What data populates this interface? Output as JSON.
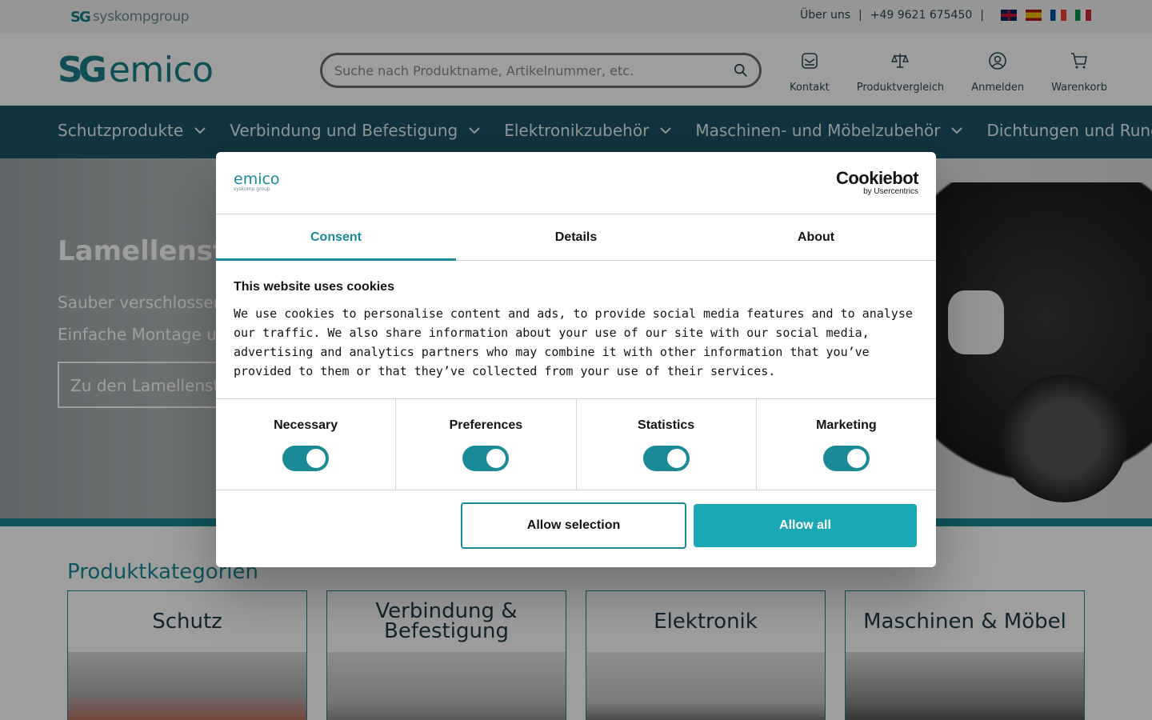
{
  "topbar": {
    "group_logo": {
      "mark": "SG",
      "name": "syskompgroup"
    },
    "links": [
      "Über uns",
      "+49 9621 675450"
    ],
    "separator": "|",
    "flags": [
      "gb",
      "es",
      "fr",
      "it"
    ]
  },
  "header": {
    "logo": {
      "mark": "SG",
      "word": "emico"
    },
    "search": {
      "placeholder": "Suche nach Produktname, Artikelnummer, etc.",
      "value": ""
    },
    "items": [
      {
        "label": "Kontakt",
        "icon": "mail-icon"
      },
      {
        "label": "Produktvergleich",
        "icon": "scale-icon"
      },
      {
        "label": "Anmelden",
        "icon": "user-icon"
      },
      {
        "label": "Warenkorb",
        "icon": "cart-icon"
      }
    ]
  },
  "nav": {
    "items": [
      "Schutzprodukte",
      "Verbindung und Befestigung",
      "Elektronikzubehör",
      "Maschinen- und Möbelzubehör",
      "Dichtungen und Rundsch"
    ]
  },
  "hero": {
    "title": "Lamellensto",
    "text1": "Sauber verschlossen",
    "text2": "Einfache Montage un",
    "button": "Zu den Lamellensto"
  },
  "categories": {
    "title": "Produktkategorien",
    "items": [
      "Schutz",
      "Verbindung & Befestigung",
      "Elektronik",
      "Maschinen & Möbel"
    ]
  },
  "cookie": {
    "logo_word": "emico",
    "logo_sub": "syskomp group",
    "provider": {
      "name": "Cookiebot",
      "by": "by Usercentrics"
    },
    "tabs": [
      "Consent",
      "Details",
      "About"
    ],
    "active_tab": "Consent",
    "title": "This website uses cookies",
    "text": "We use cookies to personalise content and ads, to provide social media features and to analyse our traffic. We also share information about your use of our site with our social media, advertising and analytics partners who may combine it with other information that you’ve provided to them or that they’ve collected from your use of their services.",
    "toggles": [
      {
        "label": "Necessary",
        "on": true
      },
      {
        "label": "Preferences",
        "on": true
      },
      {
        "label": "Statistics",
        "on": true
      },
      {
        "label": "Marketing",
        "on": true
      }
    ],
    "buttons": {
      "allow_selection": "Allow selection",
      "allow_all": "Allow all"
    }
  },
  "colors": {
    "brand_teal": "#1a8a96",
    "nav_bg": "#1d5566",
    "button_teal": "#1aa8b4"
  }
}
